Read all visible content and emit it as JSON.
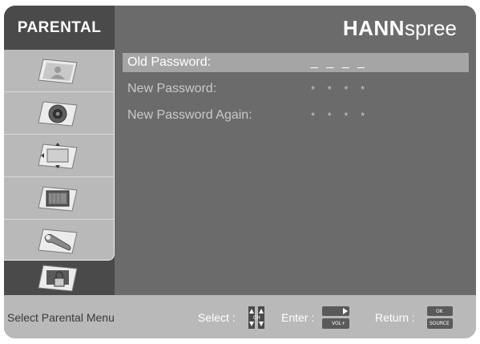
{
  "header": {
    "title": "PARENTAL",
    "brand_bold": "HANN",
    "brand_light": "spree"
  },
  "sidebar": {
    "items": [
      {
        "icon": "picture-person-icon"
      },
      {
        "icon": "audio-speaker-icon"
      },
      {
        "icon": "screen-position-icon"
      },
      {
        "icon": "tv-setup-icon"
      },
      {
        "icon": "wrench-tools-icon"
      },
      {
        "icon": "parental-lock-icon"
      }
    ]
  },
  "content": {
    "rows": [
      {
        "label": "Old Password:",
        "value": "_ _ _ _"
      },
      {
        "label": "New Password:",
        "value": "* * * *"
      },
      {
        "label": "New Password Again:",
        "value": "* * * *"
      }
    ]
  },
  "footer": {
    "hint": "Select Parental Menu",
    "select_label": "Select :",
    "select_key": "CH",
    "enter_label": "Enter :",
    "enter_key": "VOL+",
    "return_label": "Return :",
    "return_key_top": "OK",
    "return_key_bottom": "SOURCE"
  }
}
